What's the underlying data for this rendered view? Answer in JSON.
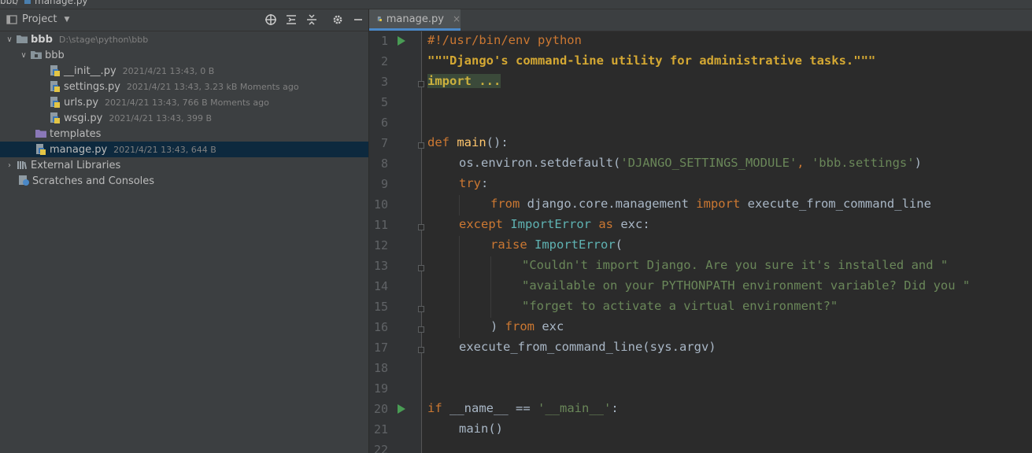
{
  "topbar": {
    "crumb_root": "bbb",
    "crumb_sep": "/",
    "crumb_file": "manage.py"
  },
  "project_panel": {
    "title": "Project",
    "header_icons": [
      "locate-icon",
      "expand-all-icon",
      "collapse-all-icon",
      "settings-icon",
      "hide-icon"
    ],
    "tree": [
      {
        "name": "bbb",
        "meta": "D:\\stage\\python\\bbb",
        "type": "folder-root",
        "expanded": true
      },
      {
        "name": "bbb",
        "meta": "",
        "type": "package",
        "expanded": true
      },
      {
        "name": "__init__.py",
        "meta": "2021/4/21 13:43, 0 B",
        "type": "python-file"
      },
      {
        "name": "settings.py",
        "meta": "2021/4/21 13:43, 3.23 kB Moments ago",
        "type": "python-file"
      },
      {
        "name": "urls.py",
        "meta": "2021/4/21 13:43, 766 B Moments ago",
        "type": "python-file"
      },
      {
        "name": "wsgi.py",
        "meta": "2021/4/21 13:43, 399 B",
        "type": "python-file"
      },
      {
        "name": "templates",
        "meta": "",
        "type": "folder"
      },
      {
        "name": "manage.py",
        "meta": "2021/4/21 13:43, 644 B",
        "type": "python-file",
        "selected": true
      },
      {
        "name": "External Libraries",
        "meta": "",
        "type": "libraries",
        "collapsed": true
      },
      {
        "name": "Scratches and Consoles",
        "meta": "",
        "type": "scratches"
      }
    ]
  },
  "editor": {
    "tab_label": "manage.py",
    "tab_close": "×",
    "line_numbers": [
      "1",
      "2",
      "3",
      "5",
      "6",
      "7",
      "8",
      "9",
      "10",
      "11",
      "12",
      "13",
      "14",
      "15",
      "16",
      "17",
      "18",
      "19",
      "20",
      "21",
      "22"
    ],
    "code": {
      "l1": "#!/usr/bin/env python",
      "l2": "\"\"\"Django's command-line utility for administrative tasks.\"\"\"",
      "l3": "import ...",
      "l7_kw": "def",
      "l7_fn": "main",
      "l7_rest": "():",
      "l8_a": "os.environ.setdefault(",
      "l8_s1": "'DJANGO_SETTINGS_MODULE'",
      "l8_b": ", ",
      "l8_s2": "'bbb.settings'",
      "l8_c": ")",
      "l9_kw": "try",
      "l9_rest": ":",
      "l10_kw1": "from",
      "l10_mod": " django.core.management ",
      "l10_kw2": "import",
      "l10_rest": " execute_from_command_line",
      "l11_kw1": "except",
      "l11_cls": " ImportError ",
      "l11_kw2": "as",
      "l11_rest": " exc:",
      "l12_kw": "raise",
      "l12_cls": " ImportError",
      "l12_rest": "(",
      "l13": "\"Couldn't import Django. Are you sure it's installed and \"",
      "l14": "\"available on your PYTHONPATH environment variable? Did you \"",
      "l15": "\"forget to activate a virtual environment?\"",
      "l16_a": ") ",
      "l16_kw": "from",
      "l16_rest": " exc",
      "l17": "execute_from_command_line(sys.argv)",
      "l20_kw": "if",
      "l20_a": " __name__ == ",
      "l20_s": "'__main__'",
      "l20_b": ":",
      "l21": "main()"
    }
  },
  "colors": {
    "keyword": "#cc7832",
    "string": "#6a8759",
    "function": "#ffc66d",
    "class": "#5fb3b3",
    "selection": "#0d293e",
    "run": "#499c54"
  }
}
